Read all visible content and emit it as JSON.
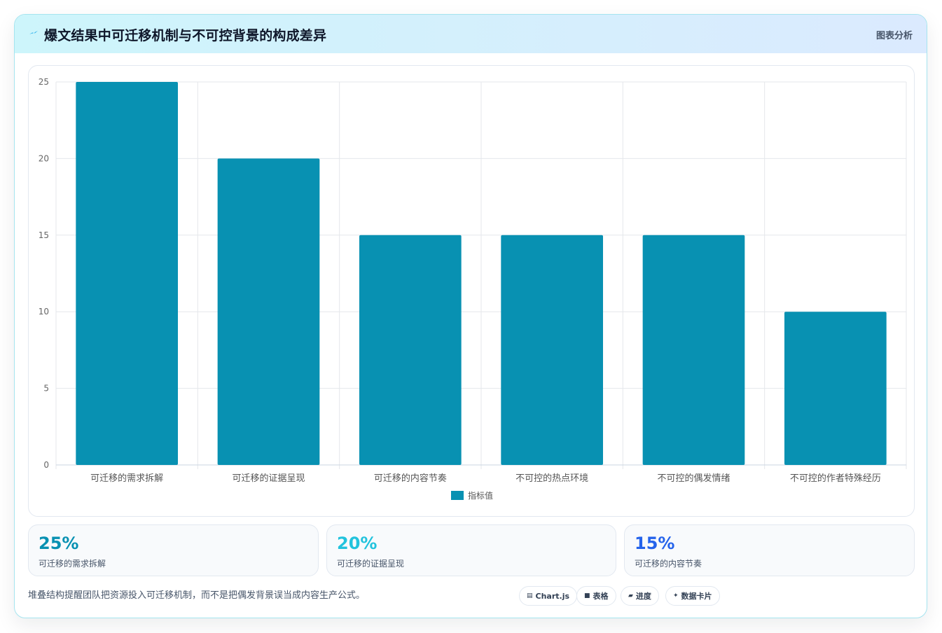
{
  "header": {
    "title": "爆文结果中可迁移机制与不可控背景的构成差异",
    "badge": "图表分析",
    "icon": "sparkle-icon"
  },
  "chart_data": {
    "type": "bar",
    "categories": [
      "可迁移的需求拆解",
      "可迁移的证据呈现",
      "可迁移的内容节奏",
      "不可控的热点环境",
      "不可控的偶发情绪",
      "不可控的作者特殊经历"
    ],
    "series": [
      {
        "name": "指标值",
        "values": [
          25,
          20,
          15,
          15,
          15,
          10
        ],
        "color": "#0891b2"
      }
    ],
    "ylim": [
      0,
      25
    ],
    "yticks": [
      0,
      5,
      10,
      15,
      20,
      25
    ],
    "grid": true,
    "legend_position": "bottom"
  },
  "stats": [
    {
      "value": "25%",
      "label": "可迁移的需求拆解",
      "color": "#0891b2"
    },
    {
      "value": "20%",
      "label": "可迁移的证据呈现",
      "color": "#22c3dd"
    },
    {
      "value": "15%",
      "label": "可迁移的内容节奏",
      "color": "#2563eb"
    }
  ],
  "footer": {
    "note": "堆叠结构提醒团队把资源投入可迁移机制，而不是把偶发背景误当成内容生产公式。",
    "pills": [
      {
        "glyph": "▤",
        "label": "Chart.js",
        "icon": "chart-icon"
      },
      {
        "glyph": "■",
        "label": "表格",
        "icon": "table-icon"
      },
      {
        "glyph": "▰",
        "label": "进度",
        "icon": "progress-icon"
      },
      {
        "glyph": "✦",
        "label": "数据卡片",
        "icon": "card-icon"
      }
    ]
  }
}
